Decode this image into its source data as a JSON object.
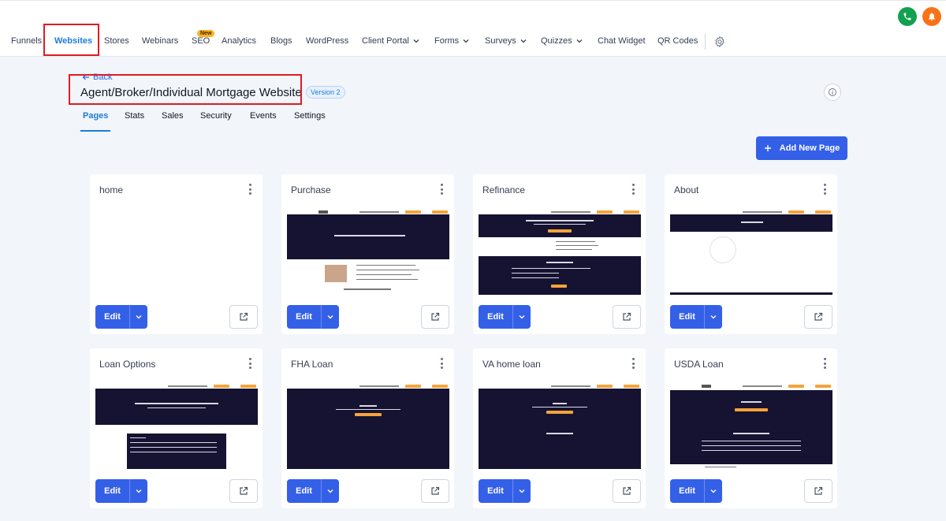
{
  "nav": {
    "items": [
      {
        "label": "Funnels",
        "active": false,
        "dropdown": false
      },
      {
        "label": "Websites",
        "active": true,
        "dropdown": false
      },
      {
        "label": "Stores",
        "active": false,
        "dropdown": false
      },
      {
        "label": "Webinars",
        "active": false,
        "dropdown": false
      },
      {
        "label": "SEO",
        "active": false,
        "dropdown": false
      },
      {
        "label": "Analytics",
        "active": false,
        "dropdown": false
      },
      {
        "label": "Blogs",
        "active": false,
        "dropdown": false
      },
      {
        "label": "WordPress",
        "active": false,
        "dropdown": false
      },
      {
        "label": "Client Portal",
        "active": false,
        "dropdown": true
      },
      {
        "label": "Forms",
        "active": false,
        "dropdown": true
      },
      {
        "label": "Surveys",
        "active": false,
        "dropdown": true
      },
      {
        "label": "Quizzes",
        "active": false,
        "dropdown": true
      },
      {
        "label": "Chat Widget",
        "active": false,
        "dropdown": false
      },
      {
        "label": "QR Codes",
        "active": false,
        "dropdown": false
      }
    ],
    "seo_badge": "New",
    "settings_icon": "gear-icon"
  },
  "top_actions": {
    "phone_icon": "phone-icon",
    "phone_color": "#12a150",
    "bell_icon": "bell-icon",
    "bell_color": "#f97316"
  },
  "header": {
    "back_label": "Back",
    "site_title": "Agent/Broker/Individual Mortgage Website",
    "version_badge": "Version 2",
    "info_icon": "info-icon"
  },
  "tabs": [
    {
      "label": "Pages",
      "active": true
    },
    {
      "label": "Stats",
      "active": false
    },
    {
      "label": "Sales",
      "active": false
    },
    {
      "label": "Security",
      "active": false
    },
    {
      "label": "Events",
      "active": false
    },
    {
      "label": "Settings",
      "active": false
    }
  ],
  "add_page_button": "Add New Page",
  "pages": [
    {
      "name": "home",
      "thumbnail": "blank"
    },
    {
      "name": "Purchase",
      "thumbnail": "purchase"
    },
    {
      "name": "Refinance",
      "thumbnail": "refinance"
    },
    {
      "name": "About",
      "thumbnail": "about"
    },
    {
      "name": "Loan Options",
      "thumbnail": "loan-options"
    },
    {
      "name": "FHA Loan",
      "thumbnail": "fha"
    },
    {
      "name": "VA home loan",
      "thumbnail": "va"
    },
    {
      "name": "USDA Loan",
      "thumbnail": "usda"
    }
  ],
  "card_actions": {
    "edit_label": "Edit"
  },
  "colors": {
    "accent": "#3460e8",
    "active_nav": "#1d7dd8",
    "highlight": "#e01b24",
    "thumb_dark": "#151331",
    "thumb_orange": "#f6a33a"
  }
}
